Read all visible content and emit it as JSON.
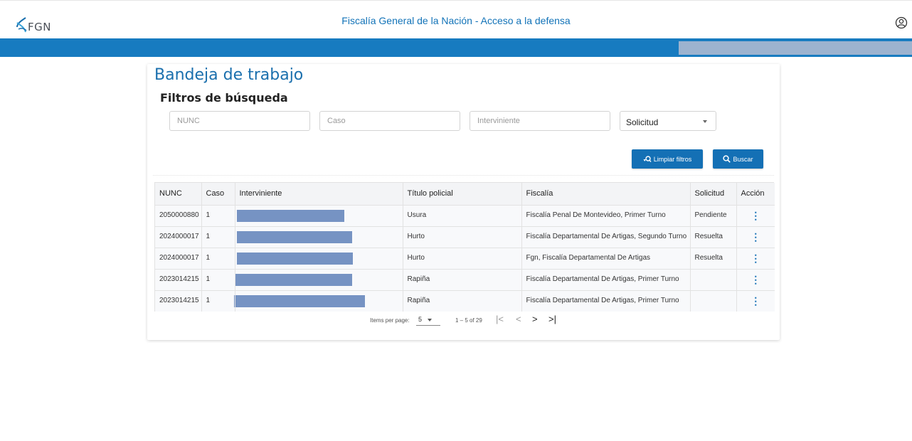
{
  "header": {
    "logo_text": "FGN",
    "app_title": "Fiscalía General de la Nación - Acceso a la defensa"
  },
  "colors": {
    "brand_blue": "#177bc0",
    "button_blue": "#1470b5",
    "title_blue": "#1a6fad",
    "redaction": "#7693c3"
  },
  "page": {
    "title": "Bandeja de trabajo",
    "filters_title": "Filtros de búsqueda"
  },
  "filters": {
    "nunc_placeholder": "NUNC",
    "caso_placeholder": "Caso",
    "interviniente_placeholder": "Interviniente",
    "solicitud_value": "Solicitud"
  },
  "buttons": {
    "clear_label": "Limpiar filtros",
    "search_label": "Buscar"
  },
  "table": {
    "headers": [
      "NUNC",
      "Caso",
      "Interviniente",
      "Título policial",
      "Fiscalía",
      "Solicitud",
      "Acción"
    ],
    "rows": [
      {
        "nunc": "2050000880",
        "caso": "1",
        "titulo": "Usura",
        "fiscalia": "Fiscalía Penal De Montevideo, Primer Turno",
        "solicitud": "Pendiente"
      },
      {
        "nunc": "2024000017",
        "caso": "1",
        "titulo": "Hurto",
        "fiscalia": "Fiscalía Departamental De Artigas, Segundo Turno",
        "solicitud": "Resuelta"
      },
      {
        "nunc": "2024000017",
        "caso": "1",
        "titulo": "Hurto",
        "fiscalia": "Fgn, Fiscalía Departamental De Artigas",
        "solicitud": "Resuelta"
      },
      {
        "nunc": "2023014215",
        "caso": "1",
        "titulo": "Rapiña",
        "fiscalia": "Fiscalía Departamental De Artigas, Primer Turno",
        "solicitud": ""
      },
      {
        "nunc": "2023014215",
        "caso": "1",
        "titulo": "Rapiña",
        "fiscalia": "Fiscalía Departamental De Artigas, Primer Turno",
        "solicitud": ""
      }
    ]
  },
  "pagination": {
    "items_per_page_label": "Items per page:",
    "items_per_page_value": "5",
    "range_label": "1 – 5 of 29"
  }
}
